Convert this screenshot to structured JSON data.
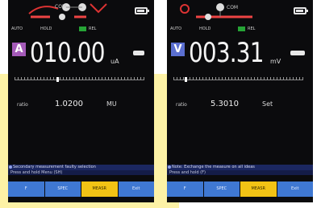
{
  "screens": [
    {
      "status": {
        "auto": "AUTO",
        "hold": "HOLD",
        "badge": "REL"
      },
      "mode_letter": "A",
      "reading": "010.00",
      "unit": "uA",
      "ratio": {
        "label": "ratio",
        "value": "1.0200",
        "unit": "MU"
      },
      "message": "Secondary measurement faulty selection",
      "sub_message": "Press and hold Menu (SH)",
      "softkeys": [
        "F",
        "SPEC",
        "MEASR",
        "Exit"
      ],
      "active_softkey": "MEASR"
    },
    {
      "status": {
        "auto": "AUTO",
        "hold": "HOLD",
        "badge": "REL"
      },
      "mode_letter": "V",
      "reading": "003.31",
      "unit": "mV",
      "ratio": {
        "label": "ratio",
        "value": "5.3010",
        "unit": "Set"
      },
      "message": "Note: Exchange the measure on all ideas",
      "sub_message": "Press and hold (F)",
      "softkeys": [
        "F",
        "SPEC",
        "MEASR",
        "Exit"
      ],
      "active_softkey": "MEASR"
    }
  ],
  "colors": {
    "screen_bg": "#0b0b0d",
    "softkey_blue": "#3f78d2",
    "softkey_active": "#f2c315",
    "mode_a": "#a45ab8",
    "mode_v": "#5b6fd0",
    "badge_green": "#26a436",
    "highlight_yellow": "#fdf2a6"
  },
  "icons": [
    "rotary-dial-icon",
    "battery-icon",
    "info-icon"
  ]
}
